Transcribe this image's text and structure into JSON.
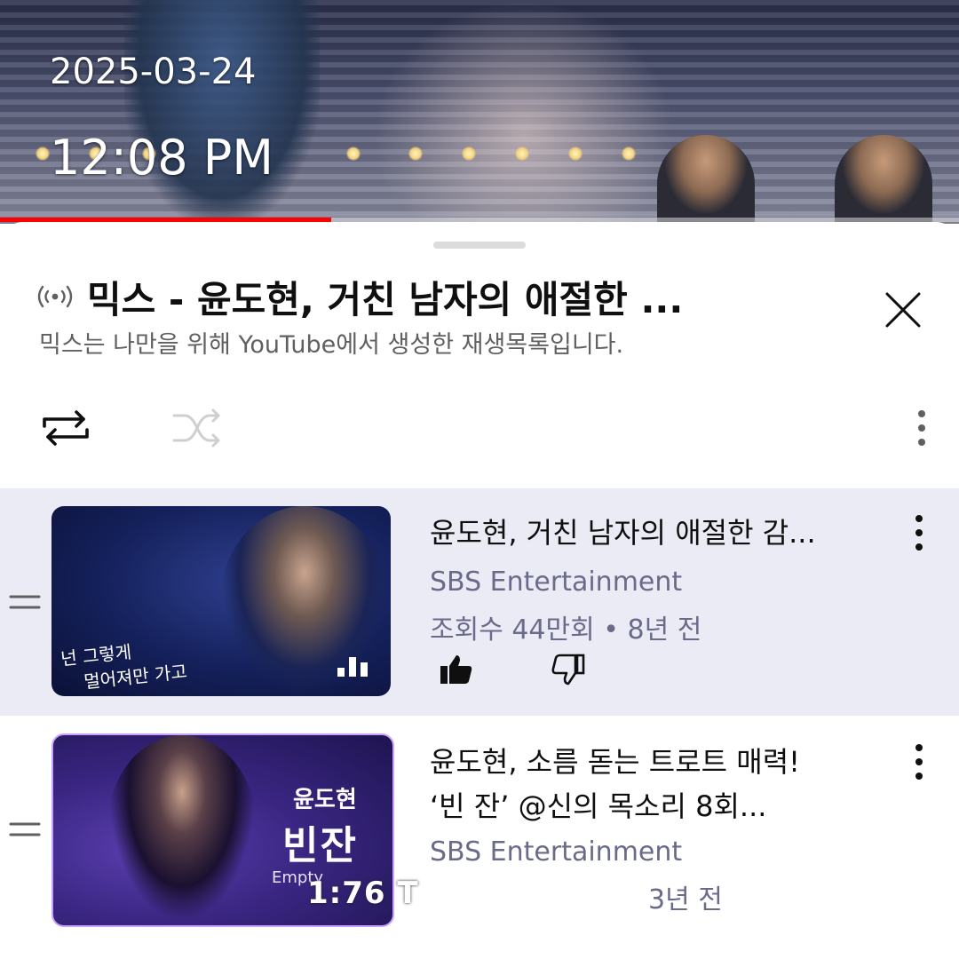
{
  "overlay": {
    "date": "2025-03-24",
    "time": "12:08 PM"
  },
  "video": {
    "progress_fraction": 0.345,
    "progress_color": "#ff0000"
  },
  "playlist": {
    "title": "믹스 - 윤도현, 거친 남자의 애절한 ...",
    "subtitle": "믹스는 나만을 위해 YouTube에서 생성한 재생목록입니다.",
    "icons": {
      "mix": "mix-broadcast-icon",
      "close": "close-icon",
      "loop": "loop-icon",
      "shuffle": "shuffle-icon",
      "more": "more-vertical-icon"
    }
  },
  "items": [
    {
      "title": "윤도현, 거친 남자의 애절한 감...",
      "channel": "SBS Entertainment",
      "meta": "조회수 44만회 • 8년 전",
      "thumbnail_caption_1": "넌 그렇게",
      "thumbnail_caption_2": "멀어져만 가고",
      "active": true
    },
    {
      "title_line1": "윤도현, 소름 돋는 트로트 매력!",
      "title_line2": "‘빈 잔’ @신의 목소리 8회...",
      "channel": "SBS Entertainment",
      "meta_partial": "3년 전",
      "thumbnail_name": "윤도현",
      "thumbnail_song": "빈잔",
      "thumbnail_en": "Empty",
      "active": false
    }
  ],
  "toast": {
    "text": "1:76 T"
  },
  "colors": {
    "active_row_bg": "#ebebf5",
    "meta_text": "#6a6a8a",
    "accent": "#ff0000"
  }
}
